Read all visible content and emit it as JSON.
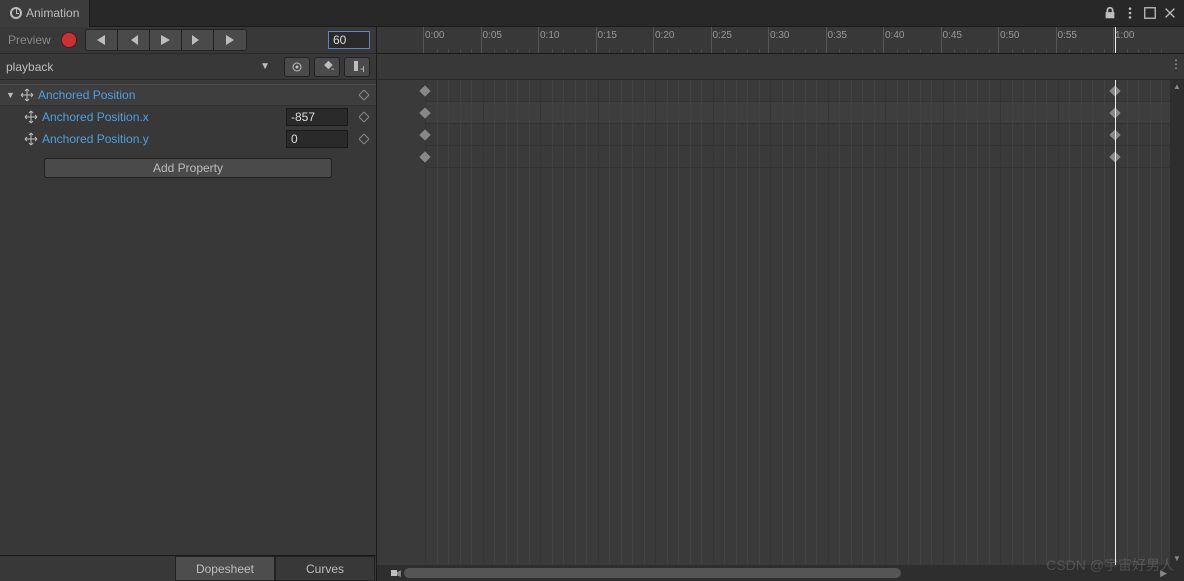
{
  "window": {
    "title": "Animation"
  },
  "toolbar": {
    "preview_label": "Preview",
    "frame_value": "60",
    "clip_name": "playback"
  },
  "timeline": {
    "ticks": [
      "0:00",
      "0:05",
      "0:10",
      "0:15",
      "0:20",
      "0:25",
      "0:30",
      "0:35",
      "0:40",
      "0:45",
      "0:50",
      "0:55",
      "1:00"
    ],
    "playhead_frame": 60,
    "keyframe_frames": [
      0,
      60
    ]
  },
  "properties": {
    "parent": {
      "label": "Anchored Position"
    },
    "children": [
      {
        "label": "Anchored Position.x",
        "value": "-857"
      },
      {
        "label": "Anchored Position.y",
        "value": "0"
      }
    ],
    "add_label": "Add Property"
  },
  "bottom_tabs": {
    "dopesheet": "Dopesheet",
    "curves": "Curves"
  },
  "watermark": "CSDN @宇宙好男人"
}
